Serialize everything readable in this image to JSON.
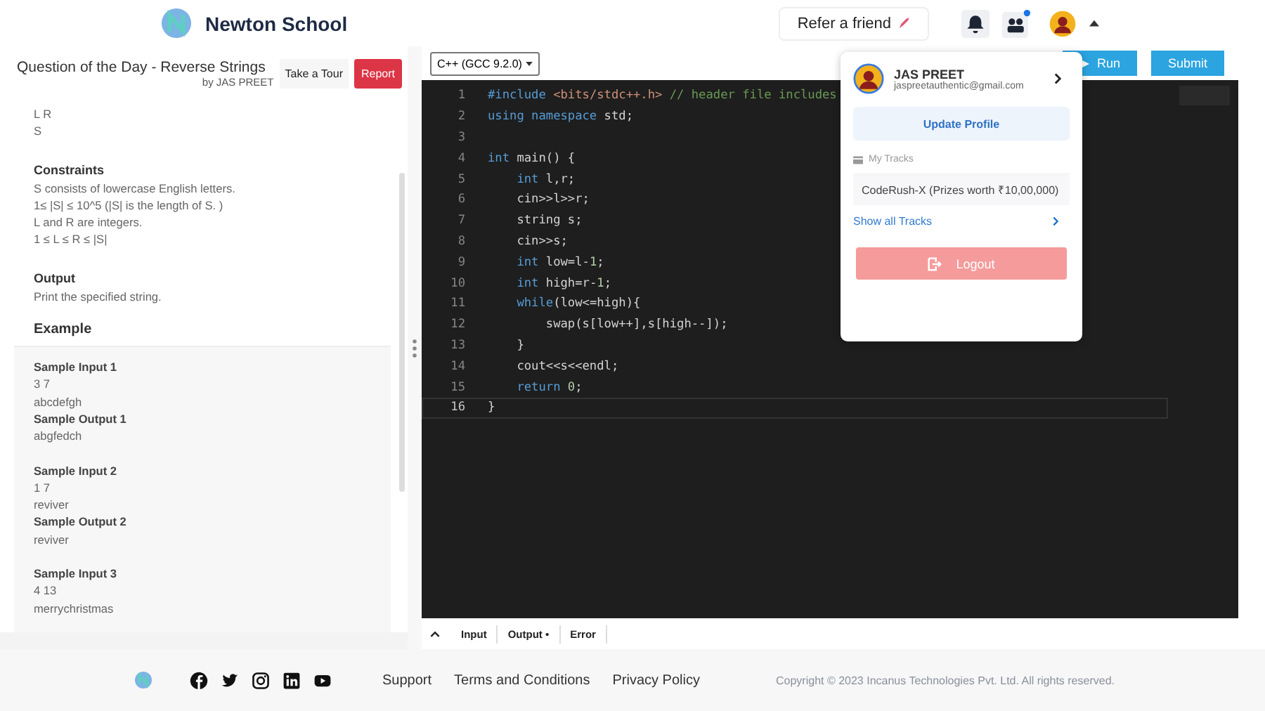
{
  "header": {
    "brand": "Newton School",
    "refer_button": "Refer a friend"
  },
  "problem": {
    "title": "Question of the Day - Reverse Strings",
    "author": "by JAS PREET",
    "tour_button": "Take a Tour",
    "report_button": "Report",
    "input_lines": [
      "L R",
      "S"
    ],
    "sections": [
      {
        "heading": "Constraints",
        "lines": [
          "S consists of lowercase English letters.",
          "1≤ |S| ≤ 10^5 (|S| is the length of S. )",
          "L and R are integers.",
          "1 ≤ L ≤ R ≤ |S|"
        ]
      },
      {
        "heading": "Output",
        "lines": [
          "Print the specified string."
        ]
      }
    ],
    "example_heading": "Example",
    "samples": [
      {
        "input_label": "Sample Input 1",
        "input": [
          "3 7",
          "abcdefgh"
        ],
        "output_label": "Sample Output 1",
        "output": [
          "abgfedch"
        ]
      },
      {
        "input_label": "Sample Input 2",
        "input": [
          "1 7",
          "reviver"
        ],
        "output_label": "Sample Output 2",
        "output": [
          "reviver"
        ]
      },
      {
        "input_label": "Sample Input 3",
        "input": [
          "4 13",
          "merrychristmas"
        ]
      }
    ]
  },
  "editor": {
    "language": "C++ (GCC 9.2.0)",
    "run_button": "Run",
    "submit_button": "Submit",
    "lines": [
      {
        "number": "1",
        "selected": false,
        "tokens": [
          {
            "kind": "keyword",
            "text": "#include "
          },
          {
            "kind": "string",
            "text": "<bits/stdc++.h>"
          },
          {
            "kind": "comment",
            "text": " // header file includes"
          }
        ]
      },
      {
        "number": "2",
        "selected": false,
        "tokens": [
          {
            "kind": "keyword",
            "text": "using namespace "
          },
          {
            "kind": "plain",
            "text": "std;"
          }
        ]
      },
      {
        "number": "3",
        "selected": false
      },
      {
        "number": "4",
        "selected": false,
        "tokens": [
          {
            "kind": "keyword",
            "text": "int "
          },
          {
            "kind": "plain",
            "text": "main() {"
          }
        ]
      },
      {
        "number": "5",
        "selected": false,
        "tokens": [
          {
            "kind": "keyword",
            "text": "    int "
          },
          {
            "kind": "plain",
            "text": "l,r;"
          }
        ]
      },
      {
        "number": "6",
        "selected": false,
        "tokens": [
          {
            "kind": "plain",
            "text": "    cin>>l>>r;"
          }
        ]
      },
      {
        "number": "7",
        "selected": false,
        "tokens": [
          {
            "kind": "plain",
            "text": "    string s;"
          }
        ]
      },
      {
        "number": "8",
        "selected": false,
        "tokens": [
          {
            "kind": "plain",
            "text": "    cin>>s;"
          }
        ]
      },
      {
        "number": "9",
        "selected": false,
        "tokens": [
          {
            "kind": "keyword",
            "text": "    int "
          },
          {
            "kind": "plain",
            "text": "low=l-"
          },
          {
            "kind": "number",
            "text": "1"
          },
          {
            "kind": "plain",
            "text": ";"
          }
        ]
      },
      {
        "number": "10",
        "selected": false,
        "tokens": [
          {
            "kind": "keyword",
            "text": "    int "
          },
          {
            "kind": "plain",
            "text": "high=r-"
          },
          {
            "kind": "number",
            "text": "1"
          },
          {
            "kind": "plain",
            "text": ";"
          }
        ]
      },
      {
        "number": "11",
        "selected": false,
        "tokens": [
          {
            "kind": "keyword",
            "text": "    while"
          },
          {
            "kind": "plain",
            "text": "(low<=high){"
          }
        ]
      },
      {
        "number": "12",
        "selected": false,
        "tokens": [
          {
            "kind": "plain",
            "text": "        swap(s[low++],s[high--]);"
          }
        ]
      },
      {
        "number": "13",
        "selected": false,
        "tokens": [
          {
            "kind": "plain",
            "text": "    }"
          }
        ]
      },
      {
        "number": "14",
        "selected": false,
        "tokens": [
          {
            "kind": "plain",
            "text": "    cout<<s<<endl;"
          }
        ]
      },
      {
        "number": "15",
        "selected": false,
        "tokens": [
          {
            "kind": "keyword",
            "text": "    return "
          },
          {
            "kind": "number",
            "text": "0"
          },
          {
            "kind": "plain",
            "text": ";"
          }
        ]
      },
      {
        "number": "16",
        "selected": true,
        "tokens": [
          {
            "kind": "plain",
            "text": "}"
          }
        ]
      }
    ],
    "bottom_tabs": [
      "Input",
      "Output •",
      "Error"
    ]
  },
  "profile_menu": {
    "name": "JAS PREET",
    "email": "jaspreetauthentic@gmail.com",
    "update_button": "Update Profile",
    "tracks_label": "My Tracks",
    "track": "CodeRush-X (Prizes worth ₹10,00,000)",
    "show_all": "Show all Tracks",
    "logout_button": "Logout"
  },
  "footer": {
    "links": [
      "Support",
      "Terms and Conditions",
      "Privacy Policy"
    ],
    "copyright": "Copyright © 2023 Incanus Technologies Pvt. Ltd. All rights reserved."
  }
}
